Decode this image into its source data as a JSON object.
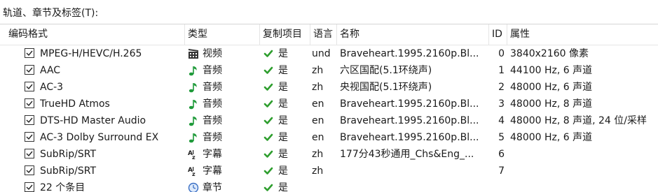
{
  "section_label": "轨道、章节及标签(T):",
  "columns": [
    "编码格式",
    "类型",
    "复制项目",
    "语言",
    "名称",
    "ID",
    "属性"
  ],
  "rows": [
    {
      "codec": "MPEG-H/HEVC/H.265",
      "icon": "video-icon",
      "type": "视频",
      "copy": "是",
      "lang": "und",
      "name": "Braveheart.1995.2160p.Bl...",
      "id": "0",
      "props": "3840x2160 像素"
    },
    {
      "codec": "AAC",
      "icon": "audio-icon",
      "type": "音频",
      "copy": "是",
      "lang": "zh",
      "name": "六区国配(5.1环绕声)",
      "id": "1",
      "props": "44100 Hz, 6 声道"
    },
    {
      "codec": "AC-3",
      "icon": "audio-icon",
      "type": "音频",
      "copy": "是",
      "lang": "zh",
      "name": "央视国配(5.1环绕声)",
      "id": "2",
      "props": "48000 Hz, 6 声道"
    },
    {
      "codec": "TrueHD Atmos",
      "icon": "audio-icon",
      "type": "音频",
      "copy": "是",
      "lang": "en",
      "name": "Braveheart.1995.2160p.Bl...",
      "id": "3",
      "props": "48000 Hz, 8 声道"
    },
    {
      "codec": "DTS-HD Master Audio",
      "icon": "audio-icon",
      "type": "音频",
      "copy": "是",
      "lang": "en",
      "name": "Braveheart.1995.2160p.Bl...",
      "id": "4",
      "props": "48000 Hz, 8 声道, 24 位/采样"
    },
    {
      "codec": "AC-3 Dolby Surround EX",
      "icon": "audio-icon",
      "type": "音频",
      "copy": "是",
      "lang": "en",
      "name": "Braveheart.1995.2160p.Bl...",
      "id": "5",
      "props": "48000 Hz, 6 声道"
    },
    {
      "codec": "SubRip/SRT",
      "icon": "subtitle-icon",
      "type": "字幕",
      "copy": "是",
      "lang": "zh",
      "name": "177分43秒通用_Chs&Eng_...",
      "id": "6",
      "props": ""
    },
    {
      "codec": "SubRip/SRT",
      "icon": "subtitle-icon",
      "type": "字幕",
      "copy": "是",
      "lang": "zh",
      "name": "",
      "id": "7",
      "props": ""
    },
    {
      "codec": "22 个条目",
      "icon": "chapter-icon",
      "type": "章节",
      "copy": "是",
      "lang": "",
      "name": "",
      "id": "",
      "props": ""
    }
  ],
  "colors": {
    "check_green": "#2e9e2e",
    "audio_green": "#1f9a3a",
    "video_dark": "#333333",
    "chapter_blue": "#3a6fc4"
  }
}
